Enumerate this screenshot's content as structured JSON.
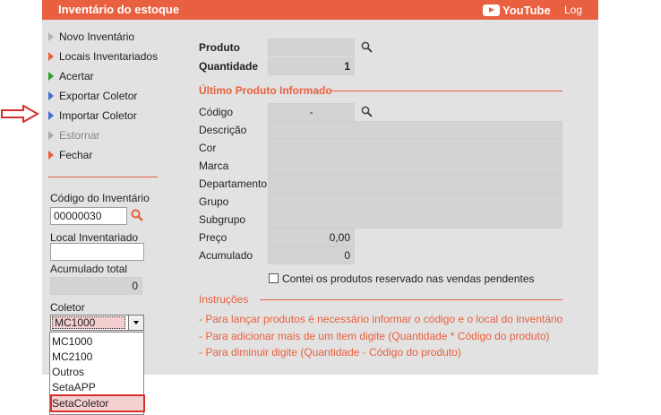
{
  "titlebar": {
    "title": "Inventário do estoque",
    "youtube_label": "YouTube",
    "log_label": "Log"
  },
  "sidebar": {
    "menu": [
      {
        "label": "Novo Inventário",
        "color": "#b5b5b5",
        "enabled": true
      },
      {
        "label": "Locais Inventariados",
        "color": "#e8603f",
        "enabled": true
      },
      {
        "label": "Acertar",
        "color": "#29a329",
        "enabled": true
      },
      {
        "label": "Exportar Coletor",
        "color": "#3f6fd0",
        "enabled": true
      },
      {
        "label": "Importar Coletor",
        "color": "#3f6fd0",
        "enabled": true
      },
      {
        "label": "Estornar",
        "color": "#aaaaaa",
        "enabled": false
      },
      {
        "label": "Fechar",
        "color": "#e8603f",
        "enabled": true
      }
    ],
    "codigo_label": "Código do Inventário",
    "codigo_value": "00000030",
    "local_label": "Local Inventariado",
    "local_value": "",
    "acumulado_label": "Acumulado total",
    "acumulado_value": "0",
    "coletor_label": "Coletor",
    "coletor_selected": "MC1000",
    "coletor_options": [
      "MC1000",
      "MC2100",
      "Outros",
      "SetaAPP",
      "SetaColetor"
    ]
  },
  "main": {
    "produto_label": "Produto",
    "produto_value": "",
    "quantidade_label": "Quantidade",
    "quantidade_value": "1",
    "ultimo_title": "Último Produto Informado",
    "fields": {
      "codigo_label": "Código",
      "codigo_value": "-",
      "descricao_label": "Descrição",
      "descricao_value": "",
      "cor_label": "Cor",
      "cor_value": "",
      "marca_label": "Marca",
      "marca_value": "",
      "departamento_label": "Departamento",
      "departamento_value": "",
      "grupo_label": "Grupo",
      "grupo_value": "",
      "subgrupo_label": "Subgrupo",
      "subgrupo_value": "",
      "preco_label": "Preço",
      "preco_value": "0,00",
      "acumulado_label": "Acumulado",
      "acumulado_value": "0"
    },
    "checkbox_label": "Contei os produtos reservado nas vendas pendentes",
    "instrucoes_title": "Instruções",
    "instrucoes": [
      "- Para lançar produtos é necessário informar o código e o local do inventário",
      "- Para adicionar mais de um item digite (Quantidade * Código do produto)",
      "- Para diminuir digite (Quantidade - Código do produto)"
    ]
  },
  "colors": {
    "accent": "#e8603f",
    "panel": "#e2e2e2",
    "highlight": "#d62f2f"
  }
}
